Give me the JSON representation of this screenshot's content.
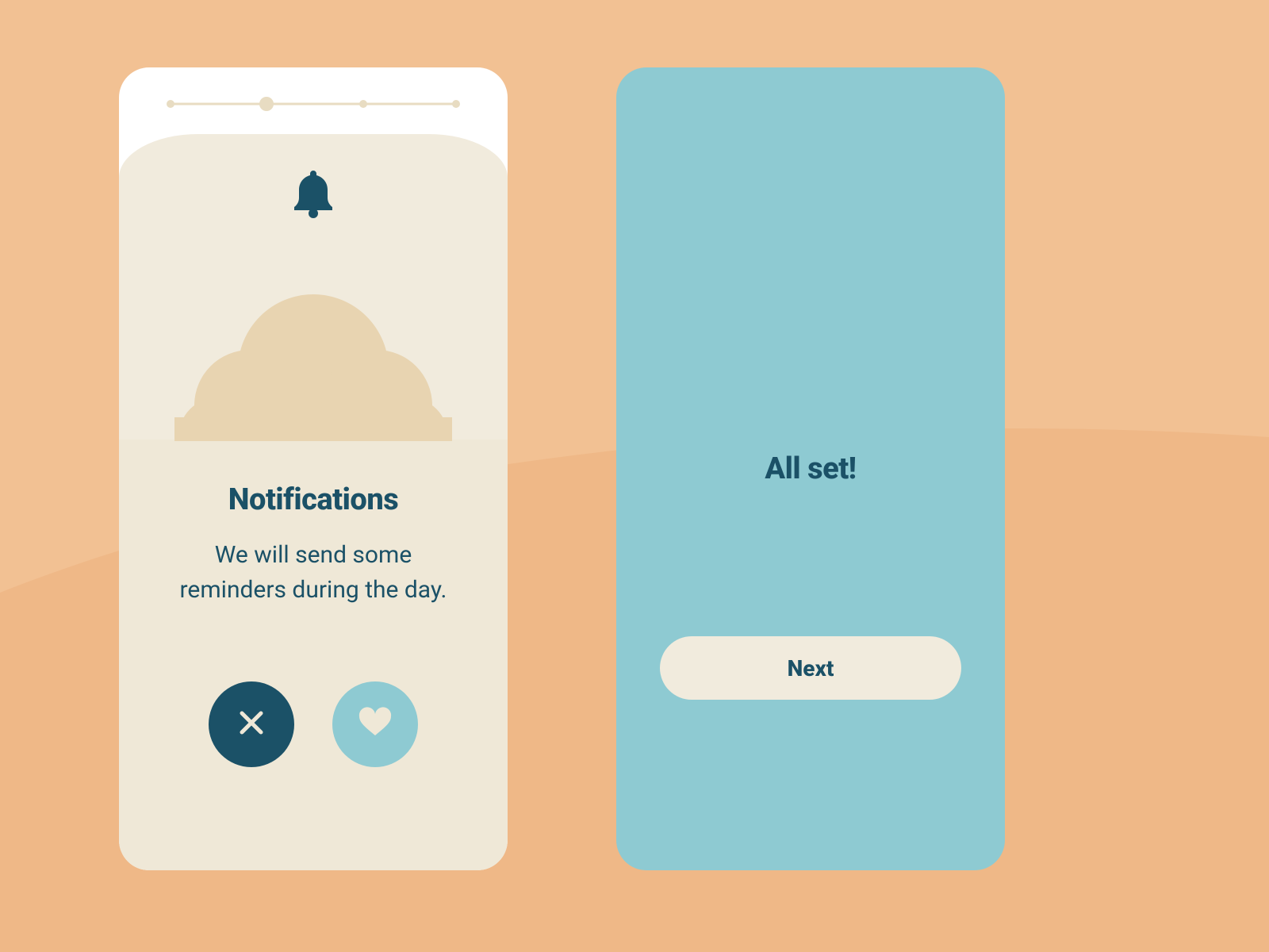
{
  "colors": {
    "background": "#f2c193",
    "wave": "#efb887",
    "leftPhoneBg": "#ffffff",
    "rightPhoneBg": "#8ecad2",
    "heroBg": "#f1ebdd",
    "bodyBg": "#efe8d7",
    "primaryText": "#1b5167",
    "stepInactive": "#e8dcc2",
    "cloud": "#e8d4b1",
    "decline": "#1b5167",
    "accept": "#8ecad2"
  },
  "stepper": {
    "total": 4,
    "activeIndex": 1
  },
  "leftScreen": {
    "icon": "bell-icon",
    "title": "Notifications",
    "subtitle": "We will send some reminders during the day.",
    "declineIcon": "close-icon",
    "acceptIcon": "heart-icon"
  },
  "rightScreen": {
    "title": "All set!",
    "buttonLabel": "Next"
  }
}
